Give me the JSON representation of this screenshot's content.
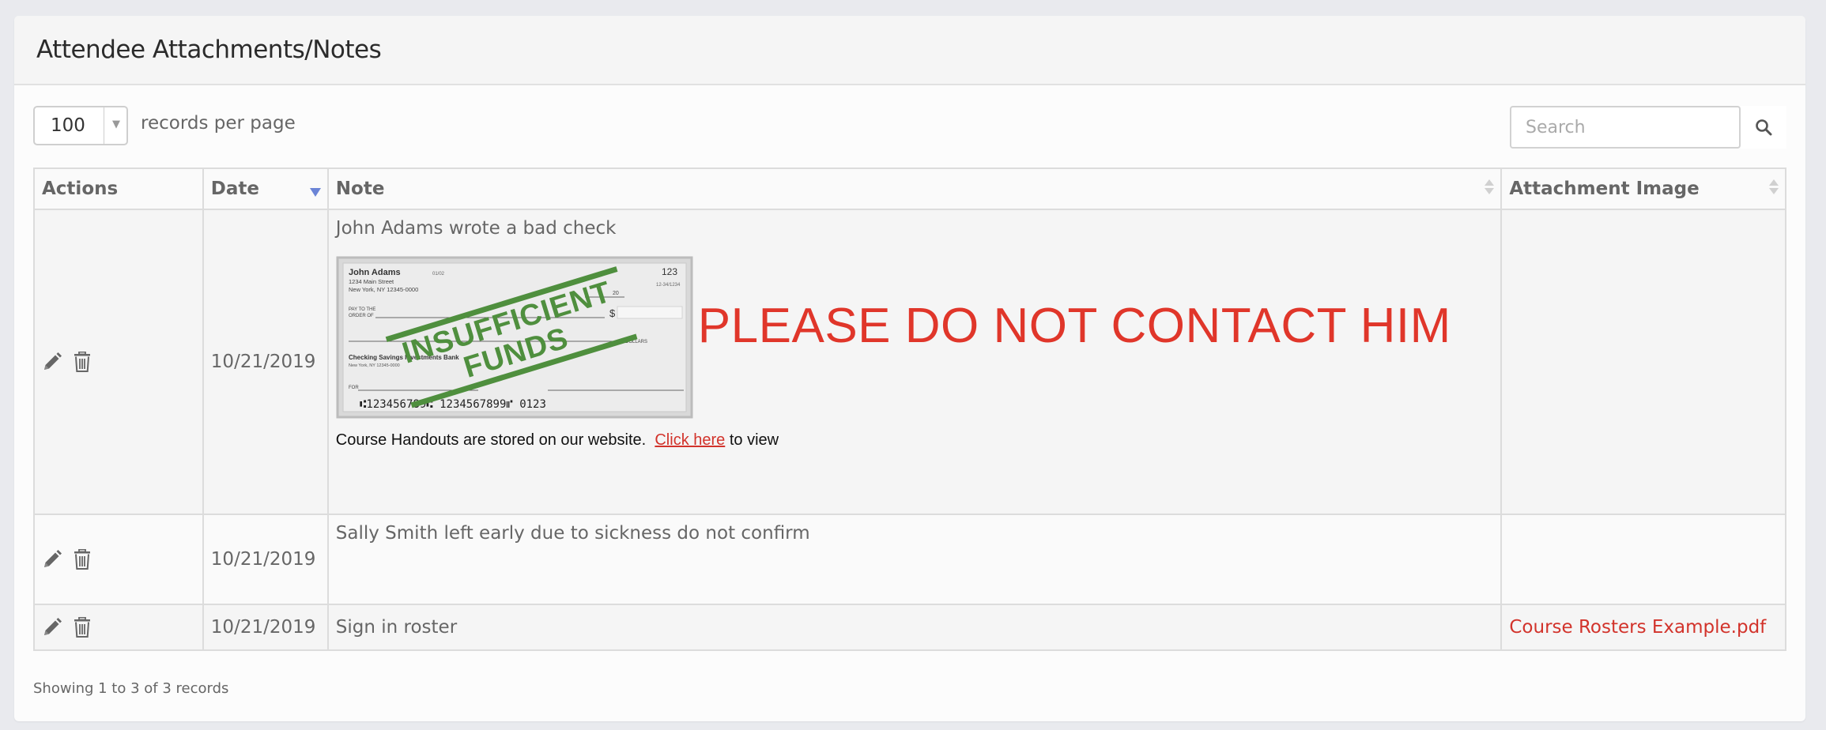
{
  "card": {
    "title": "Attendee Attachments/Notes"
  },
  "length": {
    "value": "100",
    "label": "records per page"
  },
  "search": {
    "placeholder": "Search"
  },
  "table": {
    "headers": {
      "actions": "Actions",
      "date": "Date",
      "note": "Note",
      "attachment": "Attachment Image"
    },
    "rows": [
      {
        "date": "10/21/2019",
        "note": "John Adams wrote a bad check",
        "warning": "PLEASE DO NOT CONTACT HIM",
        "handout_prefix": "Course Handouts are stored on our website.",
        "handout_link": "Click here",
        "handout_suffix": "to view",
        "attachment": ""
      },
      {
        "date": "10/21/2019",
        "note": "Sally Smith left early due to sickness do not confirm",
        "attachment": ""
      },
      {
        "date": "10/21/2019",
        "note": "Sign in roster",
        "attachment": "Course Rosters Example.pdf"
      }
    ]
  },
  "check_image": {
    "name": "John Adams",
    "address1": "1234 Main Street",
    "address2": "New York, NY 12345-0000",
    "check_number": "123",
    "routing_small": "12-34/1234",
    "date_line": "20",
    "pay_to": "PAY TO THE",
    "order_of": "ORDER OF",
    "dollar_sign": "$",
    "dollars": "DOLLARS",
    "bank": "Checking Savings Investments Bank",
    "bank_city": "New York, NY 12345-0000",
    "for_label": "FOR",
    "micr": "⑆123456789⑆  1234567899⑈  0123",
    "stamp_line1": "INSUFFICIENT",
    "stamp_line2": "FUNDS",
    "tiny_code": "01/02"
  },
  "footer": {
    "info": "Showing 1 to 3 of 3 records"
  },
  "colors": {
    "accent_red": "#d2332b",
    "sort_active": "#6b84d6",
    "stamp_green": "#4f8f3e"
  }
}
